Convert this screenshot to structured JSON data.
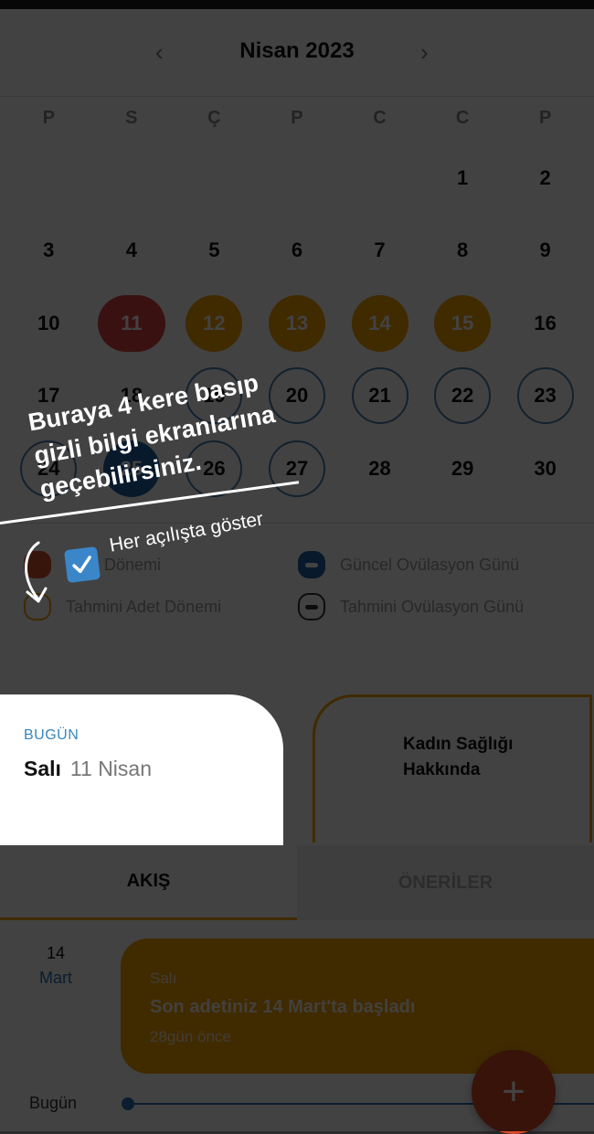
{
  "calendar": {
    "month_title": "Nisan 2023",
    "prev_icon": "‹",
    "next_icon": "›",
    "weekdays": [
      "P",
      "S",
      "Ç",
      "P",
      "C",
      "C",
      "P"
    ],
    "days": [
      {
        "label": ""
      },
      {
        "label": ""
      },
      {
        "label": ""
      },
      {
        "label": ""
      },
      {
        "label": ""
      },
      {
        "label": "1"
      },
      {
        "label": "2"
      },
      {
        "label": "3"
      },
      {
        "label": "4"
      },
      {
        "label": "5"
      },
      {
        "label": "6"
      },
      {
        "label": "7"
      },
      {
        "label": "8"
      },
      {
        "label": "9"
      },
      {
        "label": "10"
      },
      {
        "label": "11",
        "state": "period"
      },
      {
        "label": "12",
        "state": "predicted"
      },
      {
        "label": "13",
        "state": "predicted"
      },
      {
        "label": "14",
        "state": "predicted"
      },
      {
        "label": "15",
        "state": "predicted"
      },
      {
        "label": "16"
      },
      {
        "label": "17"
      },
      {
        "label": "18"
      },
      {
        "label": "19",
        "state": "fertile"
      },
      {
        "label": "20",
        "state": "fertile"
      },
      {
        "label": "21",
        "state": "fertile"
      },
      {
        "label": "22",
        "state": "fertile"
      },
      {
        "label": "23",
        "state": "fertile"
      },
      {
        "label": "24",
        "state": "fertile"
      },
      {
        "label": "25",
        "state": "today-dot"
      },
      {
        "label": "26",
        "state": "fertile"
      },
      {
        "label": "27",
        "state": "fertile"
      },
      {
        "label": "28"
      },
      {
        "label": "29"
      },
      {
        "label": "30"
      }
    ]
  },
  "legend": {
    "actual_period": "Adet Dönemi",
    "predicted_period": "Tahmini Adet Dönemi",
    "current_ovulation": "Güncel Ovülasyon Günü",
    "predicted_ovulation": "Tahmini Ovülasyon Günü"
  },
  "today_card": {
    "label": "BUGÜN",
    "weekday": "Salı",
    "date": "11 Nisan"
  },
  "health_card": {
    "title": "Kadın Sağlığı Hakkında"
  },
  "tabs": {
    "feed": "AKIŞ",
    "suggestions": "ÖNERİLER"
  },
  "feed": {
    "day": "14",
    "month": "Mart",
    "card_weekday": "Salı",
    "card_text": "Son adetiniz 14 Mart'ta başladı",
    "card_ago": "28gün önce",
    "today_label": "Bugün"
  },
  "fab": {
    "icon": "+"
  },
  "hint": {
    "line1": "Buraya 4 kere basıp",
    "line2": "gizli bilgi ekranlarına",
    "line3": "geçebilirsiniz.",
    "show_label": "Her açılışta göster"
  },
  "colors": {
    "period": "#e14141",
    "predicted": "#f5a100",
    "ovulation": "#1f63a8",
    "accent_blue": "#3a86b8"
  }
}
